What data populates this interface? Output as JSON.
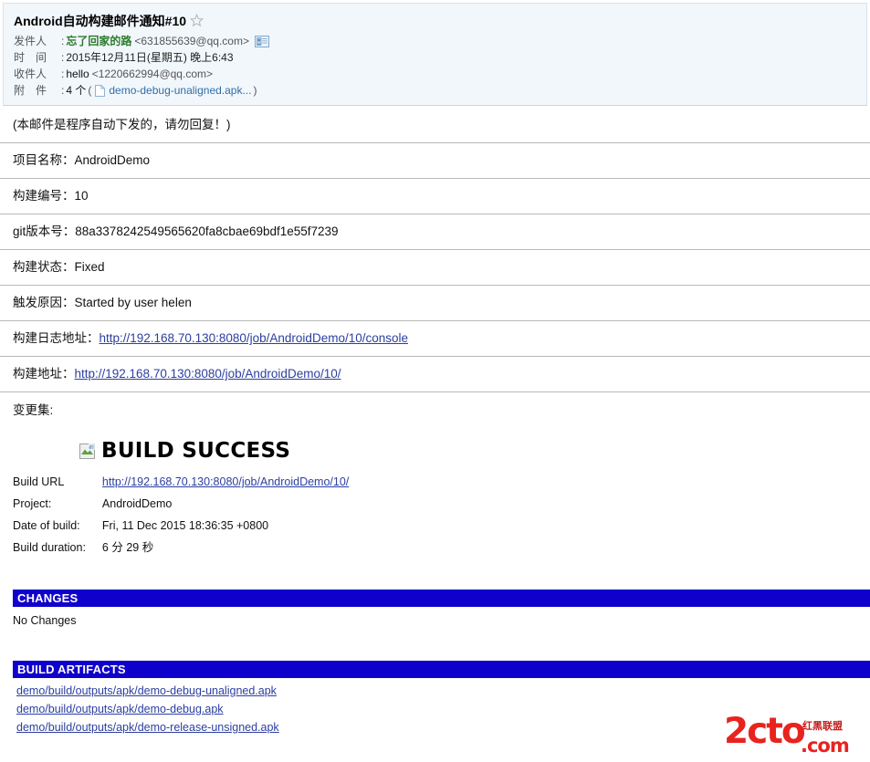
{
  "mail": {
    "subject": "Android自动构建邮件通知#10",
    "star_icon": "star-outline-icon",
    "from_label": "发件人",
    "from_name": "忘了回家的路",
    "from_address": "<631855639@qq.com>",
    "contact_icon": "contact-card-icon",
    "time_label": "时　间",
    "time_value": "2015年12月11日(星期五) 晚上6:43",
    "to_label": "收件人",
    "to_name": "hello",
    "to_address": "<1220662994@qq.com>",
    "attach_label": "附　件",
    "attach_count": "4 个",
    "attach_open_paren": "(",
    "attach_close_paren": ")",
    "attach_icon": "file-document-icon",
    "attach_name": "demo-debug-unaligned.apk..."
  },
  "notice": "(本邮件是程序自动下发的，请勿回复！)",
  "info_rows": [
    {
      "label": "项目名称：",
      "value": "AndroidDemo",
      "is_link": false
    },
    {
      "label": "构建编号：",
      "value": "10",
      "is_link": false
    },
    {
      "label": "git版本号：",
      "value": "88a3378242549565620fa8cbae69bdf1e55f7239",
      "is_link": false
    },
    {
      "label": "构建状态：",
      "value": "Fixed",
      "is_link": false
    },
    {
      "label": "触发原因：",
      "value": "Started by user helen",
      "is_link": false
    },
    {
      "label": "构建日志地址：",
      "value": "http://192.168.70.130:8080/job/AndroidDemo/10/console",
      "is_link": true
    },
    {
      "label": "构建地址：",
      "value": "http://192.168.70.130:8080/job/AndroidDemo/10/",
      "is_link": true
    },
    {
      "label": "变更集:",
      "value": "",
      "is_link": false
    }
  ],
  "jenkins": {
    "broken_image_icon": "broken-image-icon",
    "status_title": "BUILD SUCCESS",
    "fields": [
      {
        "key": "Build URL",
        "value": "http://192.168.70.130:8080/job/AndroidDemo/10/",
        "is_link": true
      },
      {
        "key": "Project:",
        "value": "AndroidDemo",
        "is_link": false
      },
      {
        "key": "Date of build:",
        "value": "Fri, 11 Dec 2015 18:36:35 +0800",
        "is_link": false
      },
      {
        "key": "Build duration:",
        "value": "6 分 29 秒",
        "is_link": false
      }
    ],
    "changes": {
      "heading": "CHANGES",
      "body": "No Changes"
    },
    "artifacts": {
      "heading": "BUILD ARTIFACTS",
      "items": [
        "demo/build/outputs/apk/demo-debug-unaligned.apk",
        "demo/build/outputs/apk/demo-debug.apk",
        "demo/build/outputs/apk/demo-release-unsigned.apk"
      ]
    }
  },
  "watermark": {
    "main": "2cto",
    "com": ".com",
    "cn": "红黑联盟"
  },
  "colors": {
    "section_bar": "#1000cc",
    "link": "#2b3fa0",
    "sender_name": "#2a7a2a",
    "header_bg": "#f2f7fc",
    "watermark_red": "#e8231f"
  }
}
